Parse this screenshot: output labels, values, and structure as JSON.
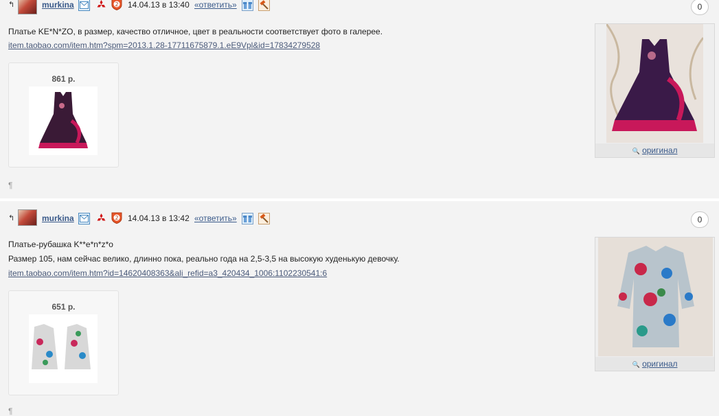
{
  "posts": [
    {
      "username": "murkina",
      "date": "14.04.13 в 13:40",
      "reply_label": "«ответить»",
      "badge_number": "2",
      "counter": "0",
      "lines": [
        "Платье KE*N*ZO, в размер, качество отличное, цвет в реальности соответствует фото в галерее."
      ],
      "link": "item.taobao.com/item.htm?spm=2013.1.28-17711675879.1.eE9Vpl&id=17834279528",
      "price": "861 р.",
      "original_label": "оригинал",
      "pilcrow": "¶"
    },
    {
      "username": "murkina",
      "date": "14.04.13 в 13:42",
      "reply_label": "«ответить»",
      "badge_number": "2",
      "counter": "0",
      "lines": [
        "Платье-рубашка K**e*n*z*o",
        "Размер 105, нам сейчас велико, длинно пока, реально года на 2,5-3,5 на высокую худенькую девочку."
      ],
      "link": "item.taobao.com/item.htm?id=14620408363&ali_refid=a3_420434_1006:1102230541:6",
      "price": "651 р.",
      "original_label": "оригинал",
      "pilcrow": "¶"
    }
  ],
  "icons": {
    "reply_arrow": "↰",
    "mail": "mail-icon",
    "brand": "mitsubishi-logo-icon",
    "shield": "level-shield-icon",
    "gift": "gift-icon",
    "hammer": "hammer-icon",
    "magnifier": "🔍"
  }
}
